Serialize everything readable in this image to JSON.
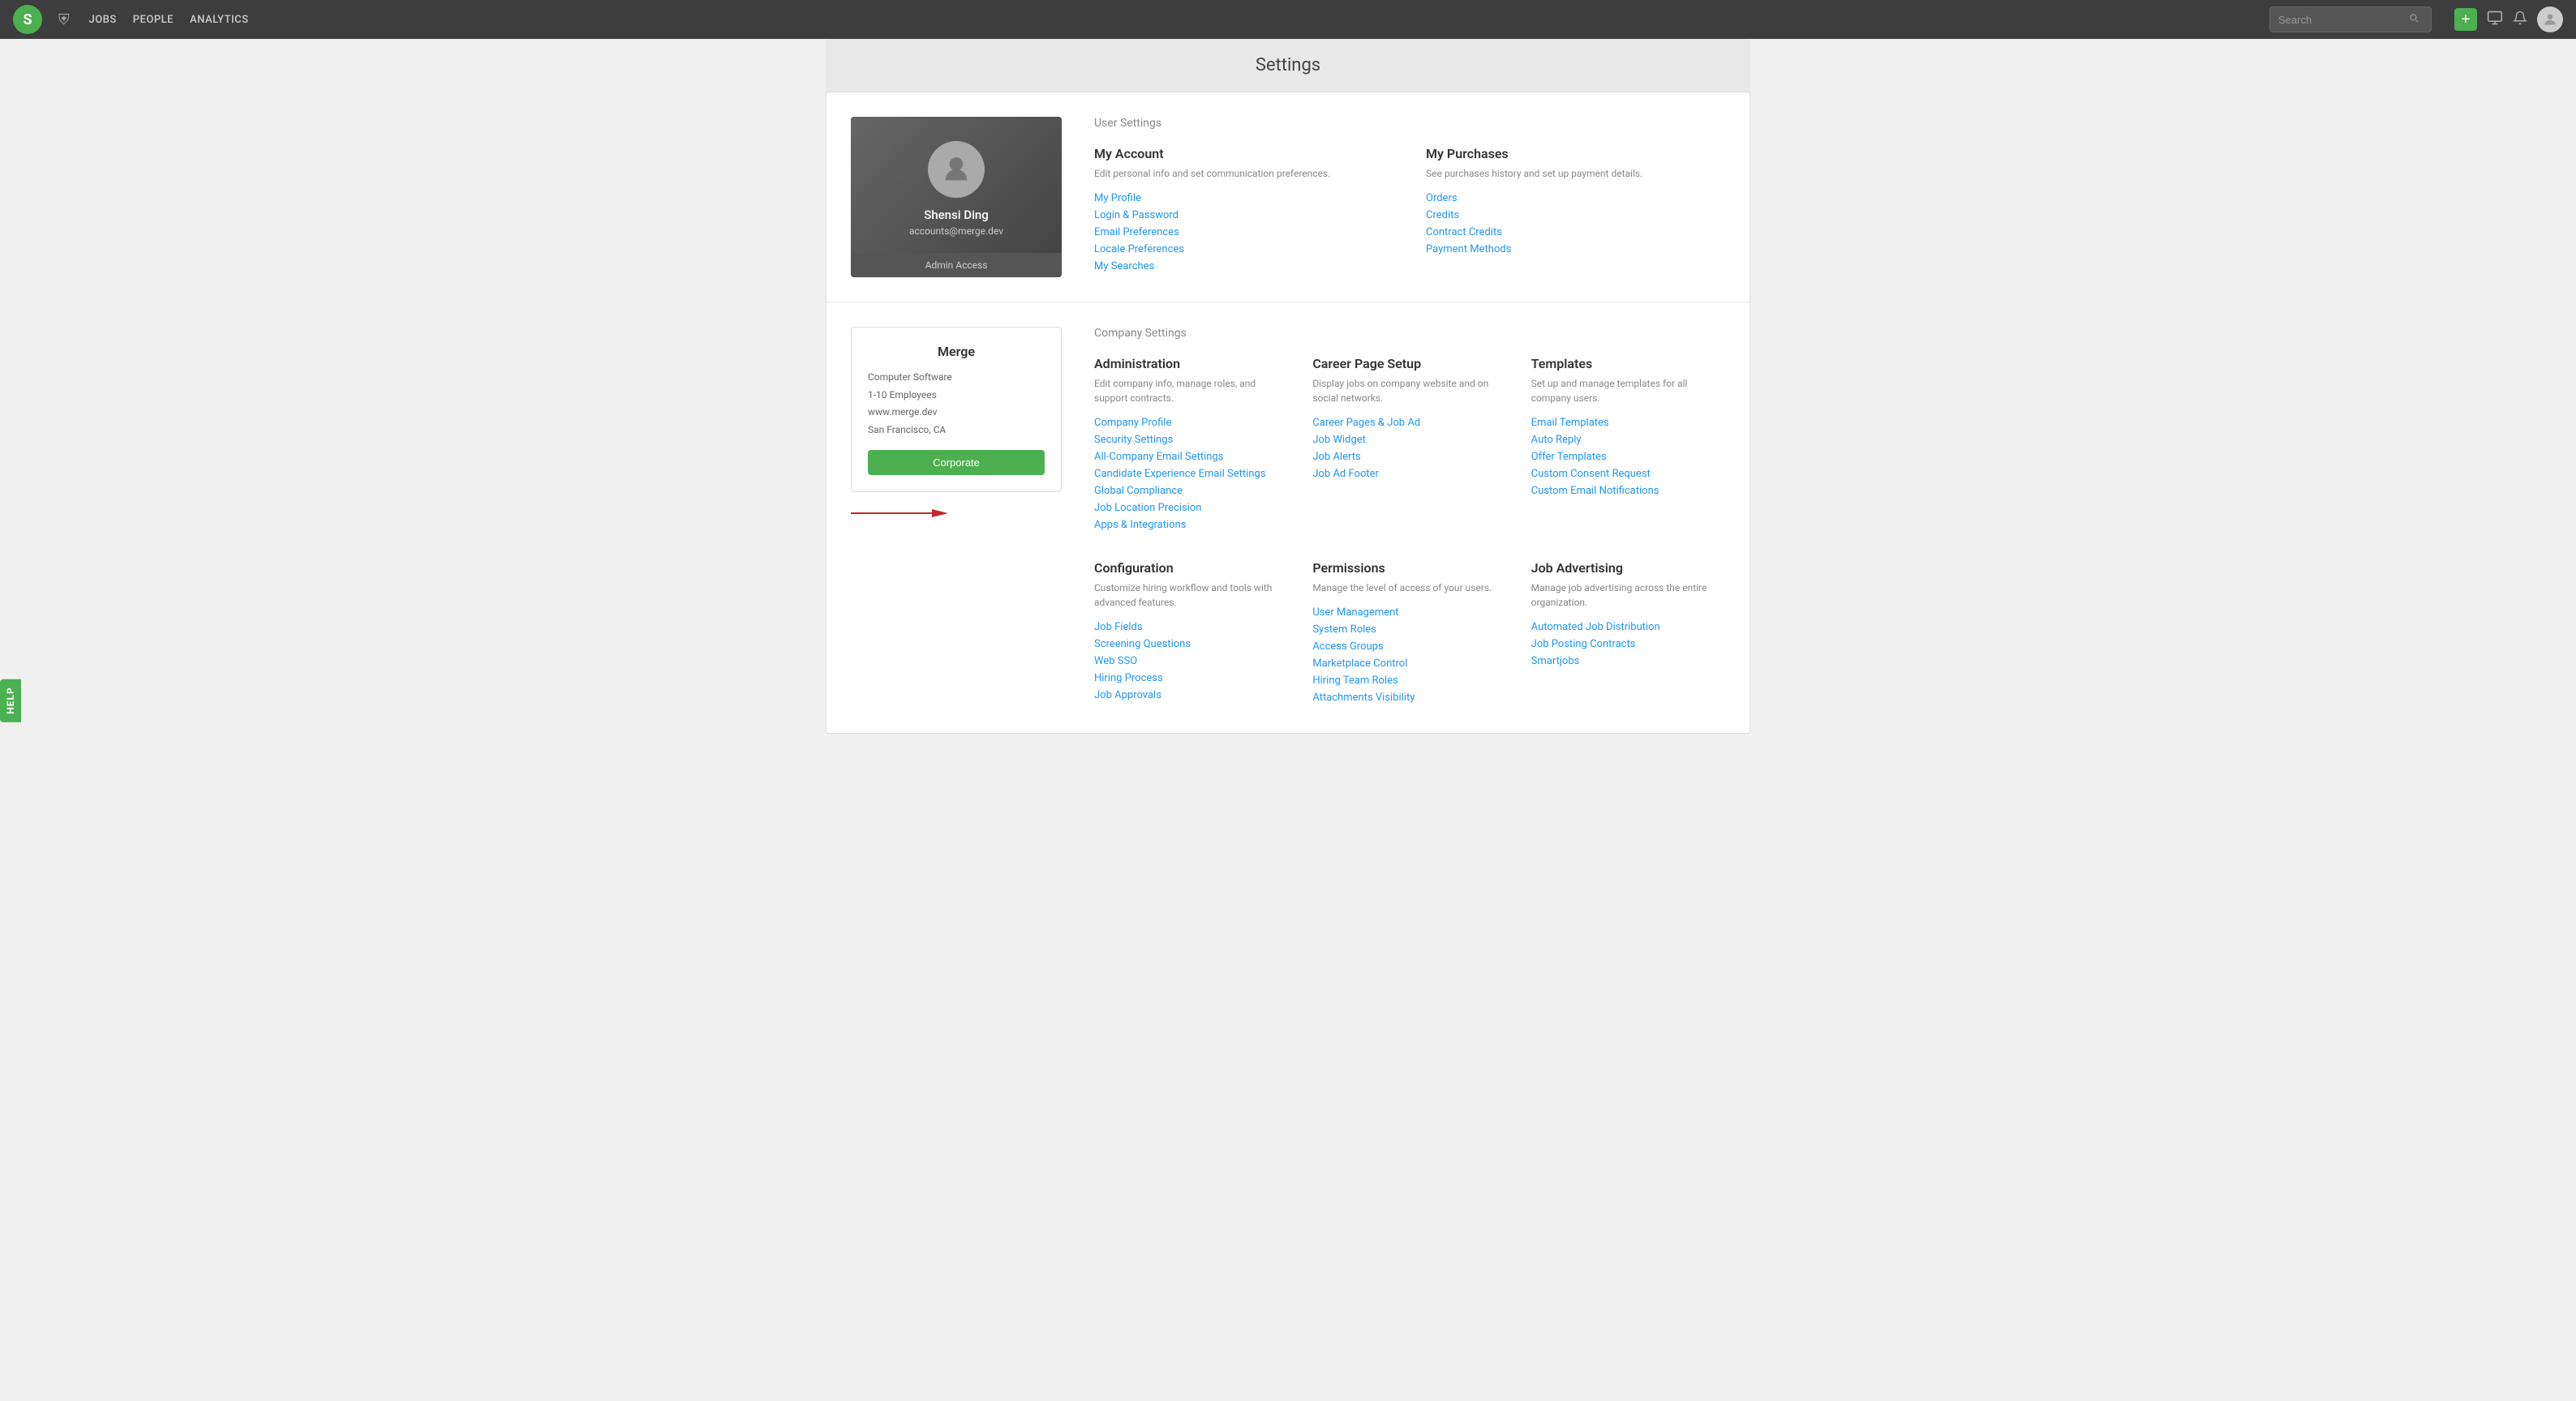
{
  "topnav": {
    "logo_letter": "S",
    "links": [
      "JOBS",
      "PEOPLE",
      "ANALYTICS"
    ],
    "search_placeholder": "Search",
    "add_label": "+",
    "help_label": "HELP"
  },
  "page": {
    "title": "Settings"
  },
  "user_settings": {
    "section_label": "User Settings",
    "profile": {
      "name": "Shensi Ding",
      "email": "accounts@merge.dev",
      "badge": "Admin Access"
    },
    "my_account": {
      "title": "My Account",
      "desc": "Edit personal info and set communication preferences.",
      "links": [
        "My Profile",
        "Login & Password",
        "Email Preferences",
        "Locale Preferences",
        "My Searches"
      ]
    },
    "my_purchases": {
      "title": "My Purchases",
      "desc": "See purchases history and set up payment details.",
      "links": [
        "Orders",
        "Credits",
        "Contract Credits",
        "Payment Methods"
      ]
    }
  },
  "company_settings": {
    "section_label": "Company Settings",
    "company": {
      "name": "Merge",
      "industry": "Computer Software",
      "size": "1-10 Employees",
      "website": "www.merge.dev",
      "location": "San Francisco, CA",
      "button": "Corporate"
    },
    "administration": {
      "title": "Administration",
      "desc": "Edit company info, manage roles, and support contracts.",
      "links": [
        "Company Profile",
        "Security Settings",
        "All-Company Email Settings",
        "Candidate Experience Email Settings",
        "Global Compliance",
        "Job Location Precision",
        "Apps & Integrations"
      ]
    },
    "career_page": {
      "title": "Career Page Setup",
      "desc": "Display jobs on company website and on social networks.",
      "links": [
        "Career Pages & Job Ad",
        "Job Widget",
        "Job Alerts",
        "Job Ad Footer"
      ]
    },
    "templates": {
      "title": "Templates",
      "desc": "Set up and manage templates for all company users.",
      "links": [
        "Email Templates",
        "Auto Reply",
        "Offer Templates",
        "Custom Consent Request",
        "Custom Email Notifications"
      ]
    },
    "configuration": {
      "title": "Configuration",
      "desc": "Customize hiring workflow and tools with advanced features.",
      "links": [
        "Job Fields",
        "Screening Questions",
        "Web SSO",
        "Hiring Process",
        "Job Approvals"
      ]
    },
    "permissions": {
      "title": "Permissions",
      "desc": "Manage the level of access of your users.",
      "links": [
        "User Management",
        "System Roles",
        "Access Groups",
        "Marketplace Control",
        "Hiring Team Roles",
        "Attachments Visibility"
      ]
    },
    "job_advertising": {
      "title": "Job Advertising",
      "desc": "Manage job advertising across the entire organization.",
      "links": [
        "Automated Job Distribution",
        "Job Posting Contracts",
        "Smartjobs"
      ]
    }
  }
}
